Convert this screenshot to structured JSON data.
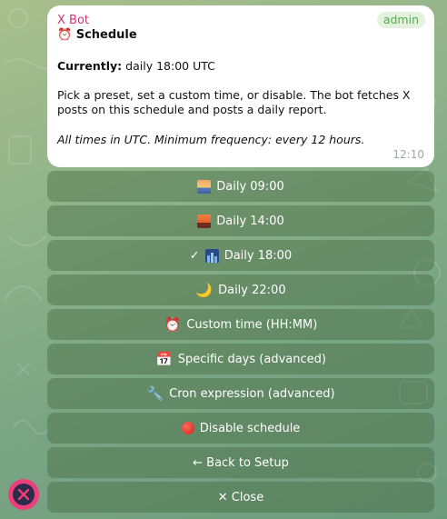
{
  "message": {
    "sender": "X Bot",
    "badge": "admin",
    "title_emoji": "⏰",
    "title": "Schedule",
    "currently_label": "Currently:",
    "currently_value": " daily 18:00 UTC",
    "description": "Pick a preset, set a custom time, or disable. The bot fetches X posts on this schedule and posts a daily report.",
    "note": "All times in UTC. Minimum frequency: every 12 hours.",
    "time": "12:10"
  },
  "keyboard": {
    "buttons": [
      {
        "label": "Daily 09:00",
        "icon": "sunrise-icon"
      },
      {
        "label": "Daily 14:00",
        "icon": "sunset-icon"
      },
      {
        "label": "Daily 18:00",
        "icon": "night-city-icon",
        "selected_mark": "✓"
      },
      {
        "label": "Daily 22:00",
        "icon": "crescent-moon-icon",
        "glyph": "🌙"
      },
      {
        "label": "Custom time (HH:MM)",
        "icon": "alarm-clock-icon",
        "glyph": "⏰"
      },
      {
        "label": "Specific days (advanced)",
        "icon": "calendar-icon",
        "glyph": "📅"
      },
      {
        "label": "Cron expression (advanced)",
        "icon": "wrench-icon",
        "glyph": "🔧"
      },
      {
        "label": "Disable schedule",
        "icon": "red-circle-icon"
      },
      {
        "label": "← Back to Setup"
      },
      {
        "label": "✕ Close"
      }
    ]
  },
  "colors": {
    "sender": "#c8387a",
    "badge_text": "#4fae4e",
    "button_bg": "rgba(66,102,62,0.42)",
    "avatar": "#ec3f7a"
  }
}
